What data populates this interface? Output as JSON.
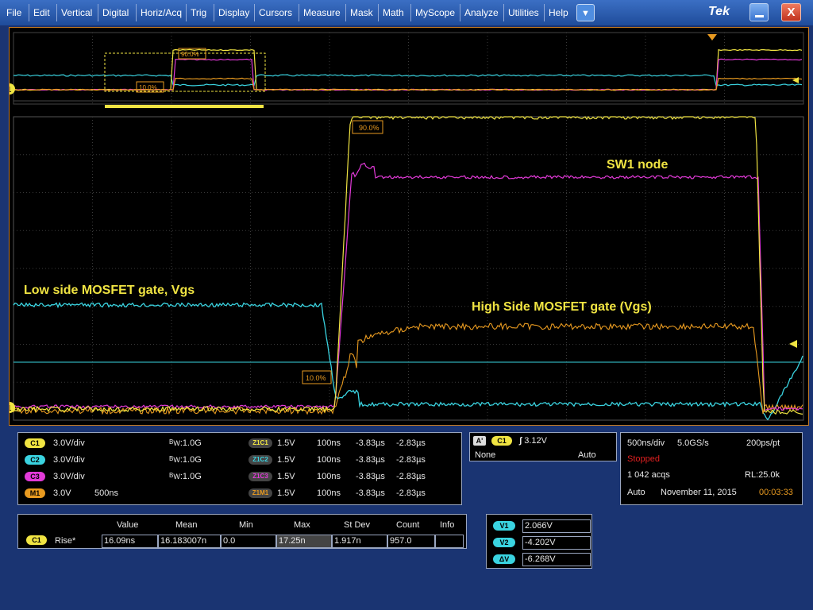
{
  "menu": [
    "File",
    "Edit",
    "Vertical",
    "Digital",
    "Horiz/Acq",
    "Trig",
    "Display",
    "Cursors",
    "Measure",
    "Mask",
    "Math",
    "MyScope",
    "Analyze",
    "Utilities",
    "Help"
  ],
  "window": {
    "brand": "Tek",
    "dropdown_glyph": "▼",
    "close_glyph": "X",
    "min_icon": "minimize-icon"
  },
  "colors": {
    "ch1": "#f0e442",
    "ch2": "#3ad3e0",
    "ch3": "#e23ad8",
    "math1": "#e89a20",
    "border": "#c37a24",
    "bg": "#1a3472"
  },
  "overview": {
    "ref_90": "90.0%",
    "ref_10": "10.0%"
  },
  "waveform": {
    "ref_90": "90.0%",
    "ref_10": "10.0%",
    "ch1_marker": "1"
  },
  "annotations": {
    "sw1": "SW1 node",
    "low_gate": "Low side MOSFET gate, Vgs",
    "high_gate": "High Side MOSFET gate (Vgs)"
  },
  "channels": [
    {
      "badge": "C1",
      "scale": "3.0V/div",
      "bw": "1.0G",
      "bw_label": "W",
      "zoom": "Z1C1",
      "zval": "1.5V",
      "ztime": "100ns",
      "zstart": "-3.83µs",
      "zend": "-2.83µs"
    },
    {
      "badge": "C2",
      "scale": "3.0V/div",
      "bw": "1.0G",
      "bw_label": "W",
      "zoom": "Z1C2",
      "zval": "1.5V",
      "ztime": "100ns",
      "zstart": "-3.83µs",
      "zend": "-2.83µs"
    },
    {
      "badge": "C3",
      "scale": "3.0V/div",
      "bw": "1.0G",
      "bw_label": "W",
      "zoom": "Z1C3",
      "zval": "1.5V",
      "ztime": "100ns",
      "zstart": "-3.83µs",
      "zend": "-2.83µs"
    },
    {
      "badge": "M1",
      "scale": "3.0V",
      "bw": "500ns",
      "bw_label": "",
      "zoom": "Z1M1",
      "zval": "1.5V",
      "ztime": "100ns",
      "zstart": "-3.83µs",
      "zend": "-2.83µs"
    }
  ],
  "trigger": {
    "mode_badge": "A'",
    "source": "C1",
    "level": "3.12V",
    "coupling": "None",
    "type": "Auto"
  },
  "acquisition": {
    "timebase": "500ns/div",
    "sample_rate": "5.0GS/s",
    "resolution": "200ps/pt",
    "state": "Stopped",
    "acqs": "1 042 acqs",
    "record_length": "RL:25.0k",
    "mode": "Auto",
    "date": "November 11, 2015",
    "time": "00:03:33"
  },
  "measurement": {
    "headers": [
      "Value",
      "Mean",
      "Min",
      "Max",
      "St Dev",
      "Count",
      "Info"
    ],
    "rows": [
      {
        "badge": "C1",
        "name": "Rise*",
        "value": "16.09ns",
        "mean": "16.183007n",
        "min": "0.0",
        "max": "17.25n",
        "stdev": "1.917n",
        "count": "957.0",
        "info": ""
      }
    ]
  },
  "cursors": [
    {
      "label": "V1",
      "value": "2.066V"
    },
    {
      "label": "V2",
      "value": "-4.202V"
    },
    {
      "label": "ΔV",
      "value": "-6.268V"
    }
  ]
}
